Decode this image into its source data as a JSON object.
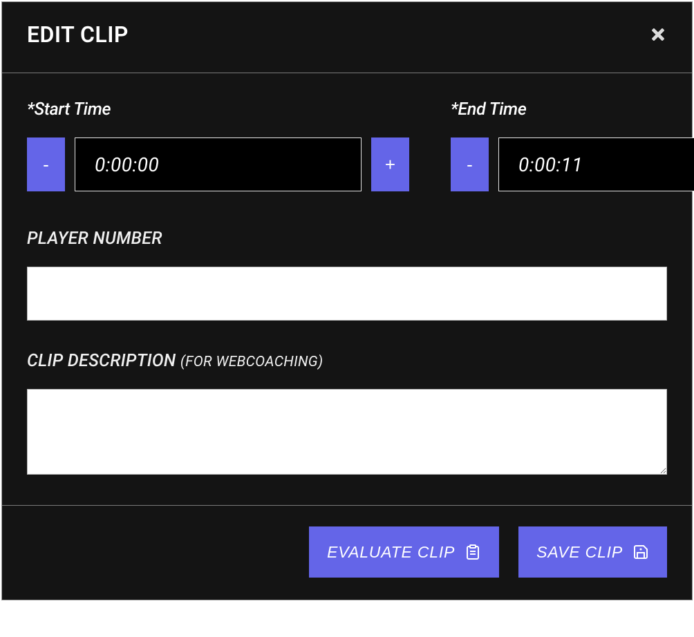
{
  "colors": {
    "accent": "#6465e8"
  },
  "header": {
    "title": "EDIT CLIP"
  },
  "start": {
    "label": "*Start Time",
    "value": "0:00:00",
    "minus": "-",
    "plus": "+"
  },
  "end": {
    "label": "*End Time",
    "value": "0:00:11",
    "minus": "-",
    "plus": "+"
  },
  "player": {
    "label": "PLAYER NUMBER",
    "value": ""
  },
  "description": {
    "label": "CLIP DESCRIPTION ",
    "label_sub": "(FOR WEBCOACHING)",
    "value": ""
  },
  "footer": {
    "evaluate": "EVALUATE CLIP",
    "save": "SAVE CLIP"
  }
}
